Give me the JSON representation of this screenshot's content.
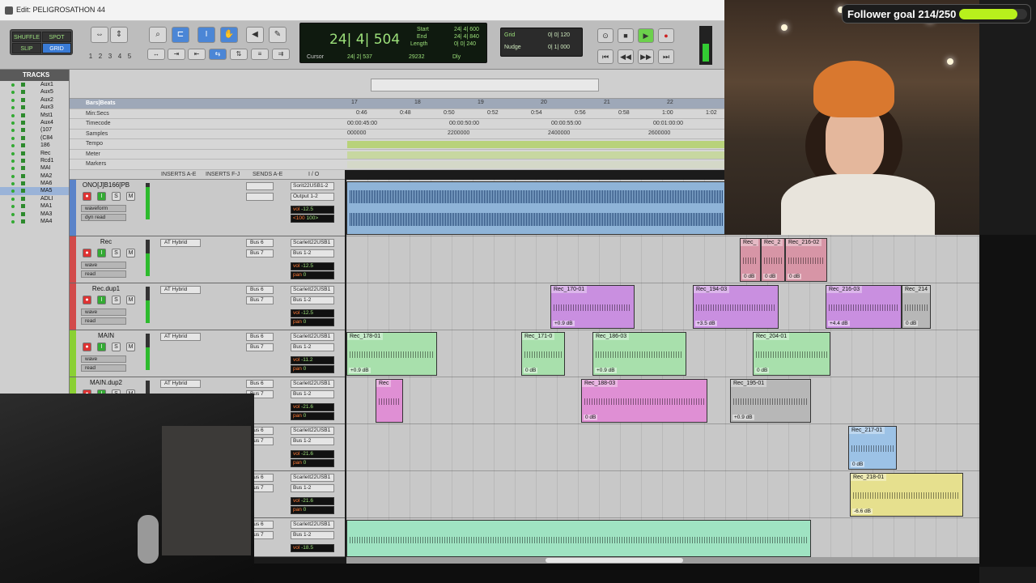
{
  "window": {
    "title": "Edit: PELIGROSATHON 44"
  },
  "modes": {
    "shuffle": "SHUFFLE",
    "spot": "SPOT",
    "slip": "SLIP",
    "grid": "GRID"
  },
  "zoom_presets": [
    "1",
    "2",
    "3",
    "4",
    "5"
  ],
  "counter": {
    "main": "24| 4| 504",
    "start_label": "Start",
    "start": "24| 4| 600",
    "end_label": "End",
    "end": "24| 4| 840",
    "length_label": "Length",
    "length": "0| 0| 240",
    "cursor_label": "Cursor",
    "cursor": "24| 2| 537",
    "samples": "29232",
    "dly": "Dly"
  },
  "grid": {
    "grid_label": "Grid",
    "grid_value": "0| 0| 120",
    "nudge_label": "Nudge",
    "nudge_value": "0| 1| 000"
  },
  "tracks_panel": {
    "title": "TRACKS",
    "items": [
      "Aux1",
      "Aux5",
      "Aux2",
      "Aux3",
      "Mst1",
      "Aux4",
      "(107",
      "(C84",
      "186",
      "Rec",
      "Rcd1",
      "MAI",
      "MA2",
      "MA6",
      "MA5",
      "ADLI",
      "MA1",
      "MA3",
      "MA4"
    ]
  },
  "rulers": {
    "bars_label": "Bars|Beats",
    "minsecs_label": "Min:Secs",
    "timecode_label": "Timecode",
    "samples_label": "Samples",
    "tempo_label": "Tempo",
    "meter_label": "Meter",
    "markers_label": "Markers",
    "bars": [
      "17",
      "18",
      "19",
      "20",
      "21",
      "22"
    ],
    "minsecs": [
      "0:46",
      "0:48",
      "0:50",
      "0:52",
      "0:54",
      "0:56",
      "0:58",
      "1:00",
      "1:02"
    ],
    "timecode": [
      "00:00:45:00",
      "00:00:50:00",
      "00:00:55:00",
      "00:01:00:00"
    ],
    "samples": [
      "000000",
      "2200000",
      "2400000",
      "2600000"
    ]
  },
  "mix_header": {
    "inserts_ae": "INSERTS A-E",
    "inserts_fj": "INSERTS F-J",
    "sends_ae": "SENDS A-E",
    "io": "I / O"
  },
  "tracks": [
    {
      "name": "ONO[J]B166[PB",
      "view": "waveform",
      "sub": "dyn   read",
      "input": "Sorit22USB1-2",
      "output": "Output 1-2",
      "vol": "vol",
      "vol_v": "-12.5",
      "pan": "<100",
      "pan_v": "100>"
    },
    {
      "name": "Rec",
      "view": "wave",
      "sub": "read",
      "insert": "AT Hybrid",
      "bus1": "Bus 6",
      "bus2": "Bus 7",
      "input": "Scarlett22USB1",
      "output": "Bus 1-2",
      "vol": "vol",
      "vol_v": "-12.5",
      "pan": "pan",
      "pan_v": "0"
    },
    {
      "name": "Rec.dup1",
      "view": "wave",
      "sub": "read",
      "insert": "AT Hybrid",
      "bus1": "Bus 6",
      "bus2": "Bus 7",
      "input": "Scarlett22USB1",
      "output": "Bus 1-2",
      "vol": "vol",
      "vol_v": "-12.5",
      "pan": "pan",
      "pan_v": "0"
    },
    {
      "name": "MAIN",
      "view": "wave",
      "sub": "read",
      "insert": "AT Hybrid",
      "bus1": "Bus 6",
      "bus2": "Bus 7",
      "input": "Scarlett22USB1",
      "output": "Bus 1-2",
      "vol": "vol",
      "vol_v": "-11.2",
      "pan": "pan",
      "pan_v": "0"
    },
    {
      "name": "MAIN.dup2",
      "view": "wave",
      "sub": "read",
      "insert": "AT Hybrid",
      "bus1": "Bus 6",
      "bus2": "Bus 7",
      "input": "Scarlett22USB1",
      "output": "Bus 1-2",
      "vol": "vol",
      "vol_v": "-21.6",
      "pan": "pan",
      "pan_v": "0"
    },
    {
      "name": "",
      "view": "",
      "sub": "",
      "insert": "",
      "bus1": "Bus 6",
      "bus2": "Bus 7",
      "input": "Scarlett22USB1",
      "output": "Bus 1-2",
      "vol": "vol",
      "vol_v": "-21.6",
      "pan": "pan",
      "pan_v": "0"
    },
    {
      "name": "",
      "view": "",
      "sub": "",
      "insert": "",
      "bus1": "Bus 6",
      "bus2": "Bus 7",
      "input": "Scarlett22USB1",
      "output": "Bus 1-2",
      "vol": "vol",
      "vol_v": "-21.6",
      "pan": "pan",
      "pan_v": "0"
    },
    {
      "name": "",
      "view": "",
      "sub": "",
      "insert": "",
      "bus1": "Bus 6",
      "bus2": "Bus 7",
      "input": "Scarlett22USB1",
      "output": "Bus 1-2",
      "vol": "vol",
      "vol_v": "-18.5",
      "pan": "",
      "pan_v": ""
    }
  ],
  "clips": {
    "rec": [
      {
        "name": "Rec_",
        "gain": "0 dB"
      },
      {
        "name": "Rec_2",
        "gain": "0 dB"
      },
      {
        "name": "Rec_216-02",
        "gain": "0 dB"
      }
    ],
    "recdup1": [
      {
        "name": "Rec_170-01",
        "gain": "+0.9 dB"
      },
      {
        "name": "Rec_194-03",
        "gain": "+3.5 dB"
      },
      {
        "name": "Rec_216-03",
        "gain": "+4.4 dB"
      },
      {
        "name": "Rec_214",
        "gain": "0 dB"
      }
    ],
    "main": [
      {
        "name": "Rec_178-01",
        "gain": "+0.9 dB"
      },
      {
        "name": "Rec_171-0",
        "gain": "0 dB"
      },
      {
        "name": "Rec_186-03",
        "gain": "+0.9 dB"
      },
      {
        "name": "Rec_204-01",
        "gain": "0 dB"
      }
    ],
    "maindup2": [
      {
        "name": "Rec",
        "gain": ""
      },
      {
        "name": "Rec_188-03",
        "gain": "0 dB"
      },
      {
        "name": "Rec_195-01",
        "gain": "+0.9 dB"
      }
    ],
    "lane6": [
      {
        "name": "Rec_217-01",
        "gain": "0 dB"
      }
    ],
    "lane7": [
      {
        "name": "Rec_218-01",
        "gain": "-6.6 dB"
      }
    ]
  },
  "overlay": {
    "goal_text": "Follower goal 214/250",
    "goal_progress": 0.856
  },
  "colors": {
    "pink": "#d795a6",
    "purple": "#c98fe0",
    "green": "#a8e0ac",
    "magenta": "#df8fd4",
    "gray": "#b7b7b7",
    "blue": "#9cc2e6",
    "yellow": "#e6e08e",
    "mint": "#9fe3c2",
    "master_blue": "#8fb4d8"
  }
}
